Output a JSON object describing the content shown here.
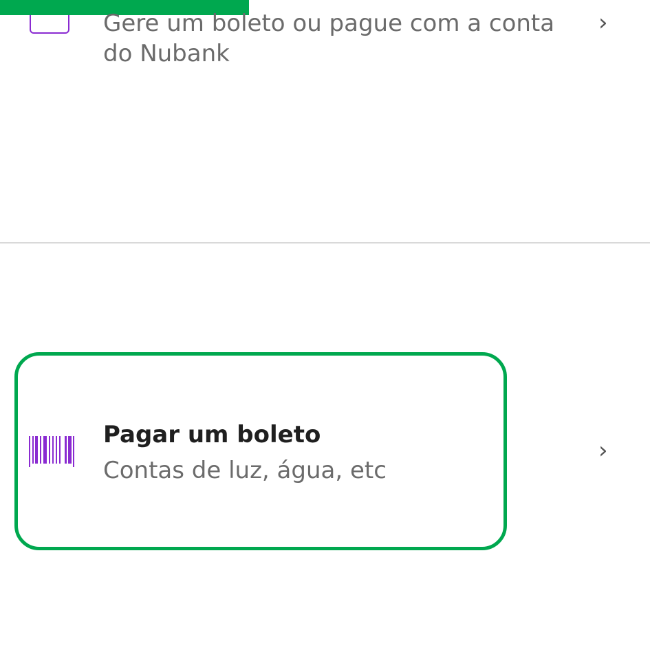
{
  "rows": {
    "boleto_generate": {
      "subtitle": "Gere um boleto ou pague com a conta do Nubank",
      "chevron": "›",
      "icon": "calendar-icon"
    },
    "pay_boleto": {
      "title": "Pagar um boleto",
      "subtitle": "Contas de luz, água, etc",
      "chevron": "›",
      "icon": "barcode-icon"
    }
  },
  "colors": {
    "accent": "#8a2bd1",
    "highlight": "#00a84f",
    "divider": "#d9d9d9",
    "title": "#1f1f1f",
    "subtitle": "#6b6b6b"
  }
}
